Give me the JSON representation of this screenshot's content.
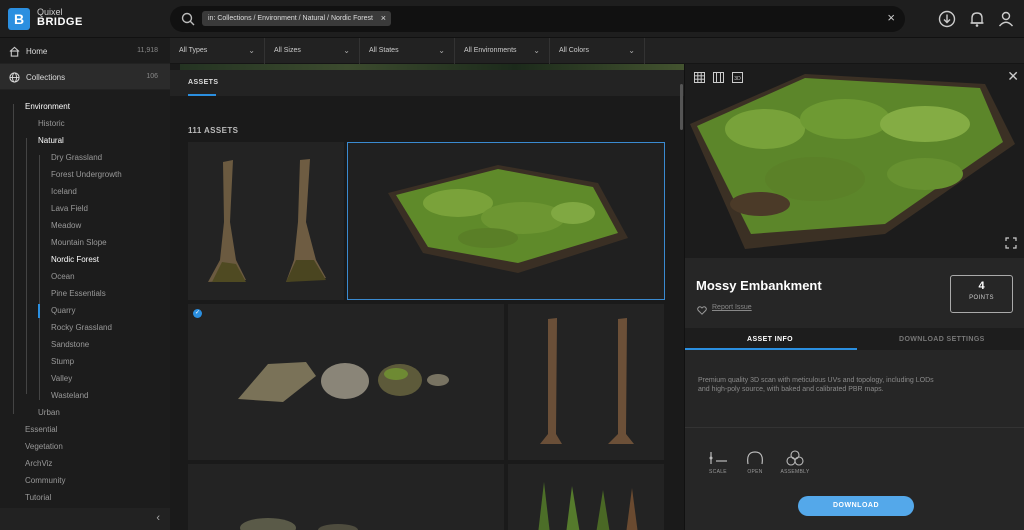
{
  "app": {
    "logo_letter": "B",
    "brand_top": "Quixel",
    "brand_bottom": "BRIDGE"
  },
  "search": {
    "chip": "in: Collections / Environment / Natural / Nordic Forest",
    "chip_remove": "×",
    "clear": "×"
  },
  "sidebar": {
    "home": {
      "label": "Home",
      "count": "11,918"
    },
    "collections": {
      "label": "Collections",
      "count": "106"
    },
    "tree": [
      {
        "label": "Environment"
      },
      {
        "label": "Historic"
      },
      {
        "label": "Natural"
      },
      {
        "label": "Dry Grassland"
      },
      {
        "label": "Forest Undergrowth"
      },
      {
        "label": "Iceland"
      },
      {
        "label": "Lava Field"
      },
      {
        "label": "Meadow"
      },
      {
        "label": "Mountain Slope"
      },
      {
        "label": "Nordic Forest"
      },
      {
        "label": "Ocean"
      },
      {
        "label": "Pine Essentials"
      },
      {
        "label": "Quarry"
      },
      {
        "label": "Rocky Grassland"
      },
      {
        "label": "Sandstone"
      },
      {
        "label": "Stump"
      },
      {
        "label": "Valley"
      },
      {
        "label": "Wasteland"
      },
      {
        "label": "Urban"
      },
      {
        "label": "Essential"
      },
      {
        "label": "Vegetation"
      },
      {
        "label": "ArchViz"
      },
      {
        "label": "Community"
      },
      {
        "label": "Tutorial"
      }
    ],
    "collapse": "‹"
  },
  "filters": [
    "All Types",
    "All Sizes",
    "All States",
    "All Environments",
    "All Colors"
  ],
  "assets": {
    "tab": "ASSETS",
    "count": "111 ASSETS",
    "check": "✓"
  },
  "detail": {
    "title": "Mossy Embankment",
    "report": "Report Issue",
    "points_value": "4",
    "points_label": "POINTS",
    "tab_info": "ASSET INFO",
    "tab_download": "DOWNLOAD SETTINGS",
    "description": "Premium quality 3D scan with meticulous UVs and topology, including LODs and high-poly source, with baked and calibrated PBR maps.",
    "facets": {
      "scale": "SCALE",
      "open": "OPEN",
      "assembly": "ASSEMBLY"
    },
    "download": "DOWNLOAD",
    "close": "✕"
  },
  "colors": {
    "accent": "#2b8fe0",
    "download": "#54a8ea",
    "moss": "#5f8a2a"
  },
  "icons": [
    "search-icon",
    "download-icon",
    "bell-icon",
    "user-icon",
    "home-icon",
    "globe-icon",
    "grid-view-icon",
    "list-view-icon",
    "3d-view-icon",
    "expand-icon",
    "heart-icon",
    "scale-icon",
    "open-icon",
    "assembly-icon"
  ]
}
